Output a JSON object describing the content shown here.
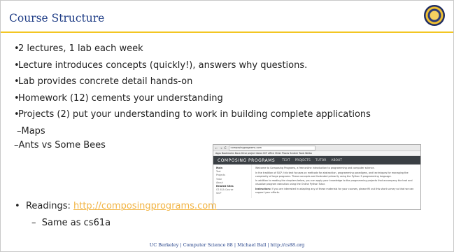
{
  "slide": {
    "title": "Course Structure",
    "bullets": [
      "2 lectures, 1 lab each week",
      "Lecture introduces concepts (quickly!), answers why questions.",
      "Lab provides concrete detail hands-on",
      "Homework (12) cements your understanding",
      "Projects (2) put your understanding to work in building complete applications"
    ],
    "sub_items": [
      "Maps",
      "Ants vs Some Bees"
    ],
    "readings_label": "Readings:",
    "readings_link": "http://composingprograms.com",
    "readings_sub": "Same as cs61a",
    "footer": "UC Berkeley | Computer Science 88 | Michael Ball | http://cs88.org"
  },
  "screenshot": {
    "address": "composingprograms.com",
    "bookmarks": "Apps   Bookmarks   Docs   Drive   project ideas   OCF   office   Other Places   Scratch   Tools   Weibo",
    "brand": "COMPOSING PROGRAMS",
    "nav": [
      "TEXT",
      "PROJECTS",
      "TUTOR",
      "ABOUT"
    ],
    "side_title": "Main",
    "side_links": [
      "Text",
      "Projects",
      "Tutor",
      "About"
    ],
    "side_title2": "Related Sites",
    "side_links2": [
      "CS 61A Course",
      "SICP"
    ],
    "para1": "Welcome to Composing Programs, a free online introduction to programming and computer science.",
    "para2": "In the tradition of SICP, this text focuses on methods for abstraction, programming paradigms, and techniques for managing the complexity of large programs. These concepts are illustrated primarily using the Python 3 programming language.",
    "para3": "In addition to reading the chapters below, you can apply your knowledge to the programming projects that accompany the text and visualize program execution using the Online Python Tutor.",
    "para4_bold": "Instructors:",
    "para4": "If you are interested in adapting any of these materials for your courses, please fill out this short survey so that we can support your efforts."
  }
}
